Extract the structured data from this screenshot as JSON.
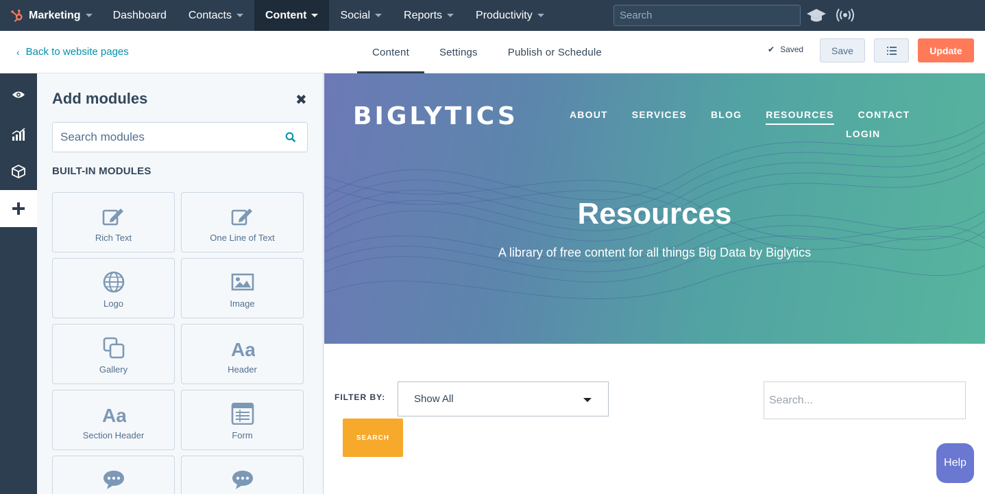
{
  "topnav": {
    "brand": "Marketing",
    "items": [
      {
        "label": "Dashboard"
      },
      {
        "label": "Contacts"
      },
      {
        "label": "Content"
      },
      {
        "label": "Social"
      },
      {
        "label": "Reports"
      },
      {
        "label": "Productivity"
      }
    ],
    "search_placeholder": "Search",
    "icons": [
      "hubspot-logo-icon",
      "graduation-cap-icon",
      "broadcast-icon"
    ]
  },
  "subheader": {
    "back_label": "Back to website pages",
    "tabs": [
      {
        "label": "Content",
        "active": true
      },
      {
        "label": "Settings"
      },
      {
        "label": "Publish or Schedule"
      }
    ],
    "saved_label": "Saved",
    "save_label": "Save",
    "update_label": "Update"
  },
  "rail": {
    "icons": [
      "eye-icon",
      "chart-icon",
      "cube-icon",
      "plus-icon"
    ]
  },
  "panel": {
    "title": "Add modules",
    "search_placeholder": "Search modules",
    "section_label": "BUILT-IN MODULES",
    "modules": [
      {
        "label": "Rich Text",
        "icon": "edit-icon"
      },
      {
        "label": "One Line of Text",
        "icon": "edit-icon"
      },
      {
        "label": "Logo",
        "icon": "globe-icon"
      },
      {
        "label": "Image",
        "icon": "image-icon"
      },
      {
        "label": "Gallery",
        "icon": "gallery-icon"
      },
      {
        "label": "Header",
        "icon": "text-aa-icon"
      },
      {
        "label": "Section Header",
        "icon": "text-aa-icon"
      },
      {
        "label": "Form",
        "icon": "form-icon"
      },
      {
        "label": "",
        "icon": "chat-bubble-icon"
      },
      {
        "label": "",
        "icon": "chat-bubble-icon"
      }
    ]
  },
  "preview": {
    "logo_text": "BIGLYTICS",
    "nav": [
      "ABOUT",
      "SERVICES",
      "BLOG",
      "RESOURCES",
      "CONTACT"
    ],
    "nav_login": "LOGIN",
    "hero_title": "Resources",
    "hero_subtitle": "A library of free content for all things Big Data by Biglytics",
    "filter_label": "FILTER BY:",
    "filter_value": "Show All",
    "search_placeholder": "Search...",
    "search_button": "SEARCH"
  },
  "help_label": "Help",
  "colors": {
    "nav_bg": "#2d3e50",
    "accent_orange": "#ff7a59",
    "link": "#0091ae",
    "search_button": "#f6a92b",
    "help": "#6a78d1"
  }
}
